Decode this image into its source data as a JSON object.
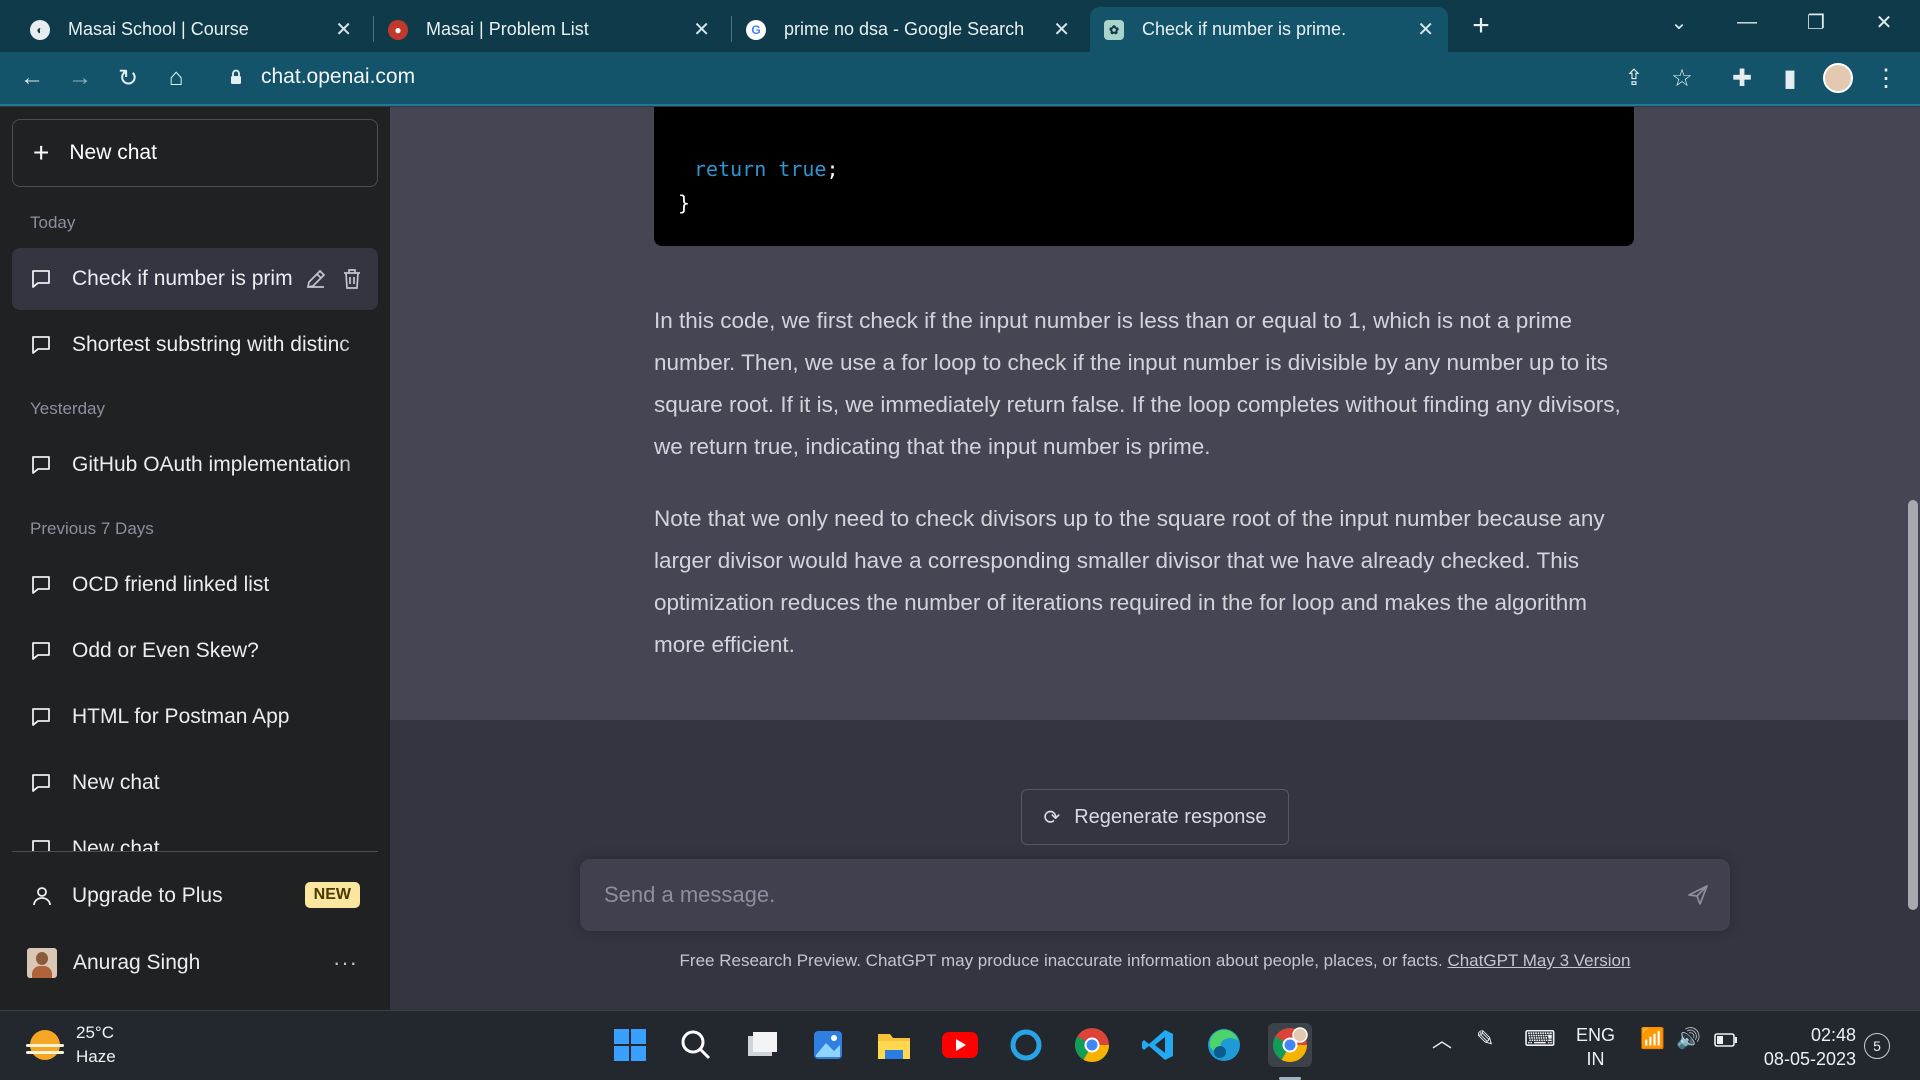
{
  "browser": {
    "tabs": [
      {
        "title": "Masai School | Course",
        "favicon": "masai-icon"
      },
      {
        "title": "Masai | Problem List",
        "favicon": "masai-problem-icon"
      },
      {
        "title": "prime no dsa - Google Search",
        "favicon": "google-icon"
      },
      {
        "title": "Check if number is prime.",
        "favicon": "chatgpt-icon",
        "active": true
      }
    ],
    "url": "chat.openai.com"
  },
  "sidebar": {
    "new_chat_label": "New chat",
    "sections": {
      "today": "Today",
      "yesterday": "Yesterday",
      "previous_7_days": "Previous 7 Days"
    },
    "items": [
      {
        "label": "Check if number is prim"
      },
      {
        "label": "Shortest substring with distinc"
      },
      {
        "label": "GitHub OAuth implementation"
      },
      {
        "label": "OCD friend linked list"
      },
      {
        "label": "Odd or Even Skew?"
      },
      {
        "label": "HTML for Postman App"
      },
      {
        "label": "New chat"
      },
      {
        "label": "New chat"
      }
    ],
    "upgrade_label": "Upgrade to Plus",
    "upgrade_badge": "NEW",
    "user_name": "Anurag Singh",
    "more_label": "···"
  },
  "main": {
    "code": {
      "line1_keyword": "return true",
      "line1_punct": ";",
      "line2": "}"
    },
    "paragraphs": [
      "In this code, we first check if the input number is less than or equal to 1, which is not a prime number. Then, we use a for loop to check if the input number is divisible by any number up to its square root. If it is, we immediately return false. If the loop completes without finding any divisors, we return true, indicating that the input number is prime.",
      "Note that we only need to check divisors up to the square root of the input number because any larger divisor would have a corresponding smaller divisor that we have already checked. This optimization reduces the number of iterations required in the for loop and makes the algorithm more efficient."
    ],
    "regenerate_label": "Regenerate response",
    "composer_placeholder": "Send a message.",
    "footer_text": "Free Research Preview. ChatGPT may produce inaccurate information about people, places, or facts. ",
    "footer_link": "ChatGPT May 3 Version"
  },
  "taskbar": {
    "weather_temp": "25°C",
    "weather_desc": "Haze",
    "lang_top": "ENG",
    "lang_bottom": "IN",
    "time": "02:48",
    "date": "08-05-2023",
    "notification_count": "5"
  },
  "colors": {
    "sidebar_bg": "#202123",
    "main_bg": "#444654",
    "composer_bg": "#40414f",
    "browser_toolbar": "#14546a",
    "code_keyword": "#2e95d3",
    "badge_bg": "#fae69e"
  }
}
